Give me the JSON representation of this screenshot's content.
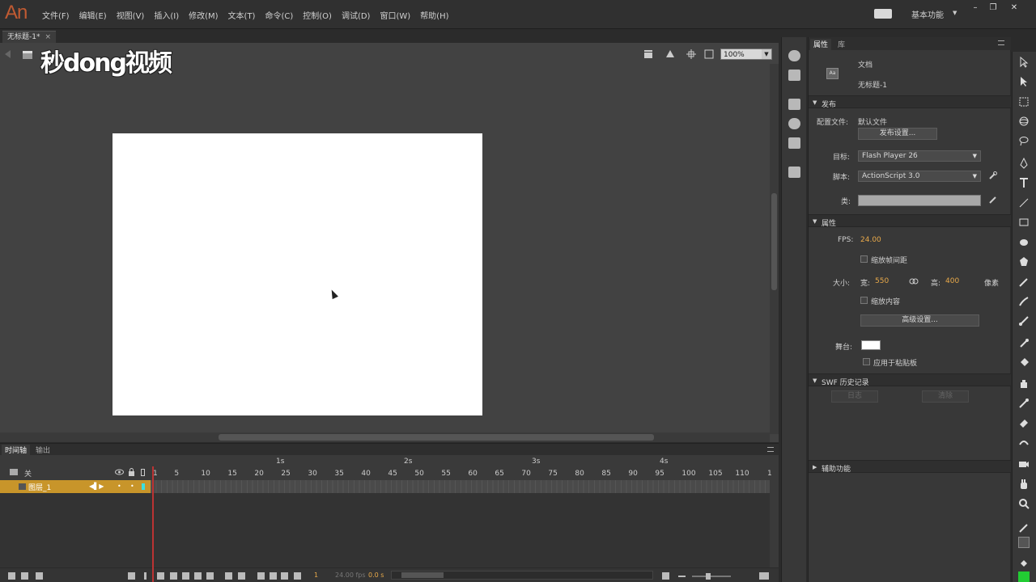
{
  "app": {
    "logo": "An",
    "menu": [
      "文件(F)",
      "编辑(E)",
      "视图(V)",
      "插入(I)",
      "修改(M)",
      "文本(T)",
      "命令(C)",
      "控制(O)",
      "调试(D)",
      "窗口(W)",
      "帮助(H)"
    ],
    "workspace": "基本功能",
    "window_controls": [
      "–",
      "❐",
      "✕"
    ]
  },
  "document": {
    "tab_title": "无标题-1*",
    "watermark": "秒dong视频",
    "zoom": "100%"
  },
  "properties": {
    "tabs": [
      "属性",
      "库"
    ],
    "doc_icon_text": "Aa",
    "doc_type": "文档",
    "doc_name": "无标题-1",
    "publish_section": "发布",
    "profile_label": "配置文件:",
    "profile_value": "默认文件",
    "publish_settings_button": "发布设置...",
    "target_label": "目标:",
    "target_value": "Flash Player 26",
    "script_label": "脚本:",
    "script_value": "ActionScript 3.0",
    "class_label": "类:",
    "props_section": "属性",
    "fps_label": "FPS:",
    "fps_value": "24.00",
    "scale_spans_label": "缩放帧间距",
    "size_label": "大小:",
    "width_label": "宽:",
    "width_value": "550",
    "height_label": "高:",
    "height_value": "400",
    "units": "像素",
    "scale_content_label": "缩放内容",
    "advanced_button": "高级设置...",
    "stage_label": "舞台:",
    "stage_color": "#ffffff",
    "apply_pasteboard_label": "应用于粘贴板",
    "swf_history_section": "SWF 历史记录",
    "log_button": "日志",
    "clear_button": "清除",
    "accessibility_section": "辅助功能"
  },
  "timeline": {
    "tabs": [
      "时间轴",
      "输出"
    ],
    "header_label": "关",
    "layer_name": "图层_1",
    "second_marks": [
      "1s",
      "2s",
      "3s",
      "4s"
    ],
    "frame_numbers": [
      "1",
      "5",
      "10",
      "15",
      "20",
      "25",
      "30",
      "35",
      "40",
      "45",
      "50",
      "55",
      "60",
      "65",
      "70",
      "75",
      "80",
      "85",
      "90",
      "95",
      "100",
      "105",
      "110",
      "1"
    ],
    "current_frame": "1",
    "fps_readout": "24.00 fps",
    "time_readout": "0.0 s"
  },
  "colors": {
    "accent_orange": "#e8a94a",
    "layer_highlight": "#c8952a",
    "playhead": "#b33333",
    "logo": "#c05a32"
  }
}
